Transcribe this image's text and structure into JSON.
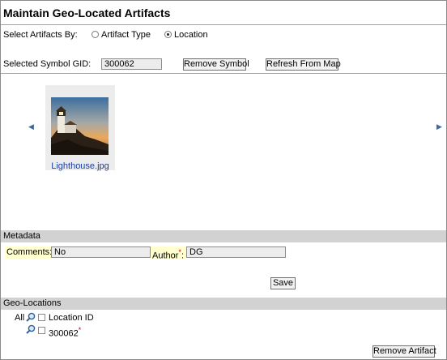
{
  "page": {
    "title": "Maintain Geo-Located Artifacts"
  },
  "select_by": {
    "label": "Select Artifacts By:",
    "options": [
      "Artifact Type",
      "Location"
    ],
    "selected": "Location"
  },
  "symbol": {
    "label": "Selected Symbol GID:",
    "gid_value": "300062",
    "remove_button": "Remove Symbol",
    "refresh_button": "Refresh From Map"
  },
  "gallery": {
    "items": [
      {
        "filename": "Lighthouse.jpg"
      }
    ]
  },
  "metadata": {
    "header": "Metadata",
    "comments_label": "Comments:",
    "comments_value": "No",
    "author_label": "Author",
    "author_required": "*",
    "author_colon": ":",
    "author_value": "DG",
    "save_button": "Save"
  },
  "geo_locations": {
    "header": "Geo-Locations",
    "all_label": "All",
    "column_header": "Location ID",
    "rows": [
      {
        "location_id": "300062",
        "required": "*"
      }
    ],
    "remove_button": "Remove Artifact"
  },
  "colors": {
    "section_bar": "#d2d2d2",
    "highlight": "#ffffd0",
    "link": "#1a3fa0",
    "required": "#cc0000"
  }
}
